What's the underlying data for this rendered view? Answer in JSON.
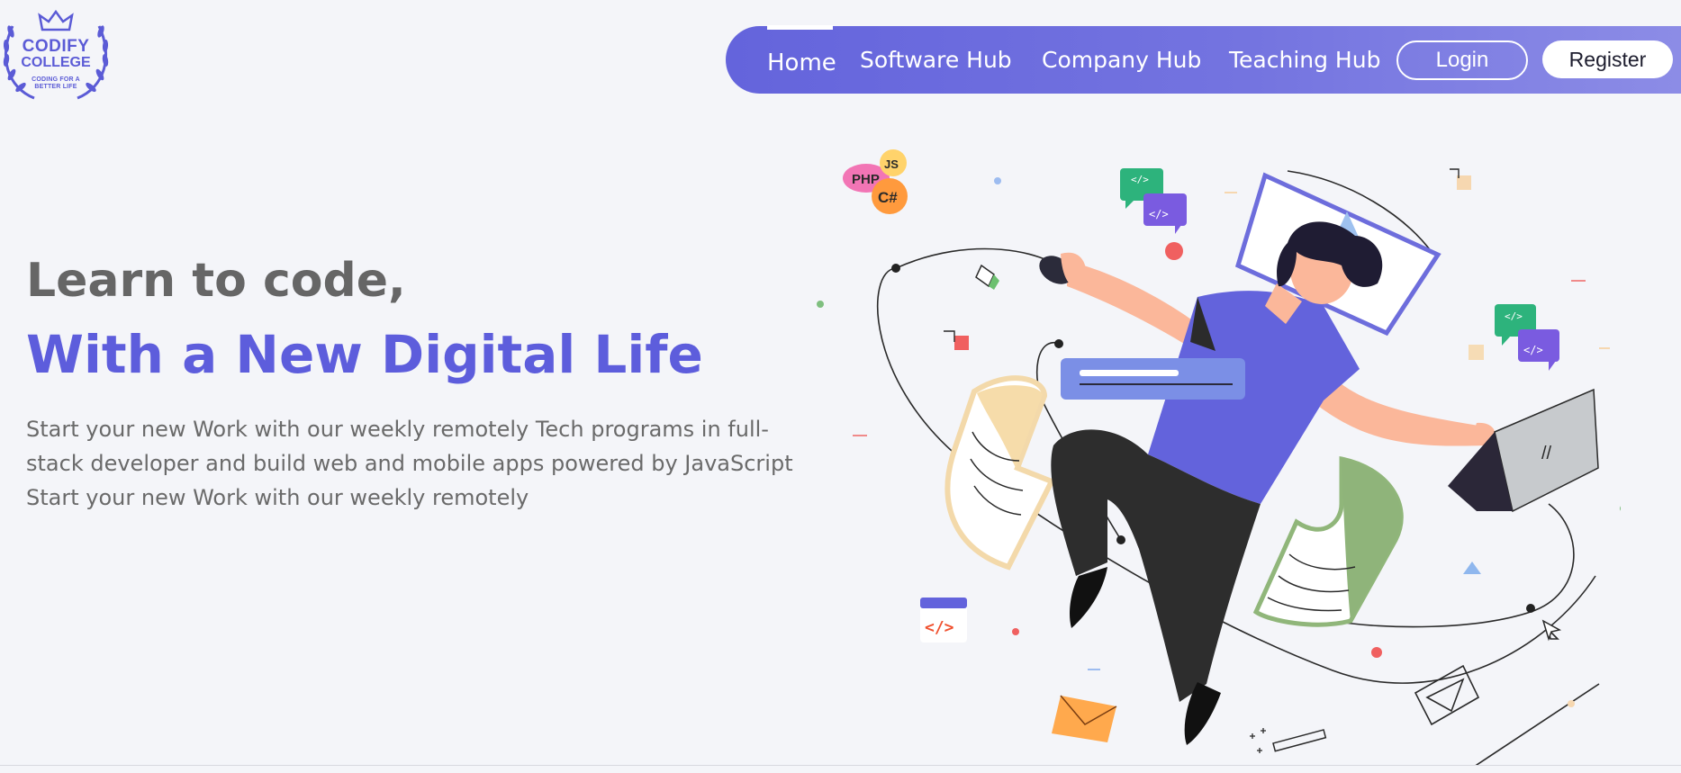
{
  "logo": {
    "line1": "CODIFY",
    "line2": "COLLEGE",
    "tagline": "CODING FOR A BETTER LIFE"
  },
  "nav": {
    "items": [
      "Home",
      "Software Hub",
      "Company Hub",
      "Teaching Hub"
    ],
    "active": "Home",
    "login": "Login",
    "register": "Register"
  },
  "hero": {
    "title_line1": "Learn to code,",
    "title_line2": "With a New Digital Life",
    "description": "Start your new Work with our weekly remotely Tech programs in full-stack developer and build web and mobile apps powered by JavaScript Start your new Work with our weekly remotely"
  },
  "illustration": {
    "language_bubbles": [
      "PHP",
      "JS",
      "C#"
    ],
    "code_tag": "</>",
    "laptop_mark": "//"
  },
  "colors": {
    "brand": "#5d5ddc",
    "nav_start": "#6464dc",
    "nav_end": "#8c8ce6",
    "heading_gray": "#666666",
    "body_text": "#6a6a6a",
    "background": "#f4f5f9"
  }
}
